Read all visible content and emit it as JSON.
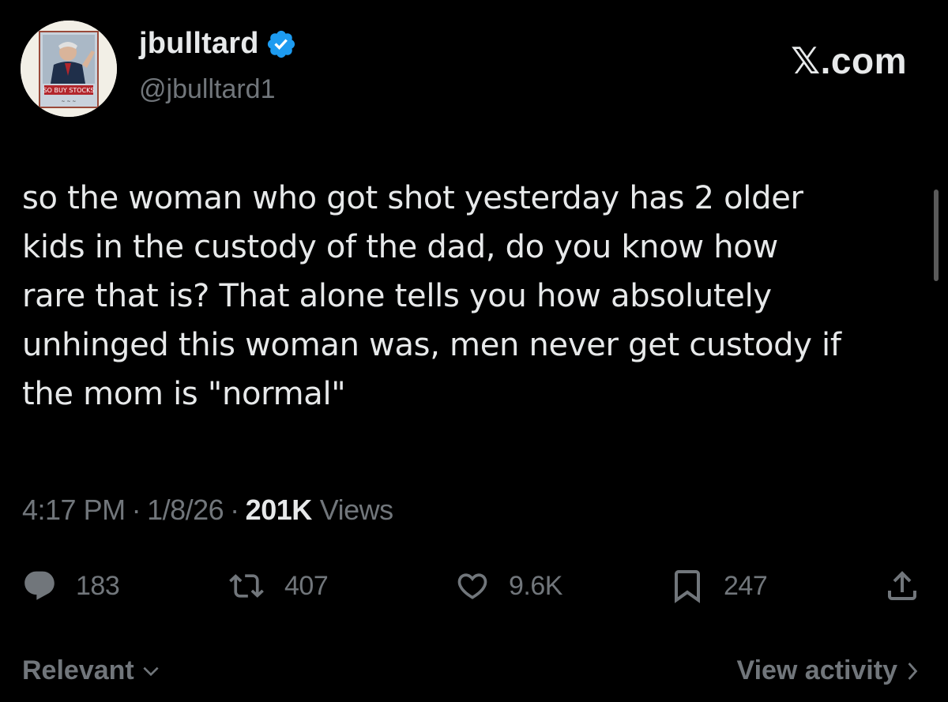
{
  "author": {
    "display_name": "jbulltard",
    "handle": "@jbulltard1",
    "verified": true,
    "avatar_icon": "avatar-image"
  },
  "brand": "𝕏.com",
  "tweet": {
    "text": "so the woman who got shot yesterday has 2 older\nkids in the custody of the dad, do you know how\nrare that is? That alone tells you how absolutely\nunhinged this woman was, men never get custody if\nthe mom is \"normal\""
  },
  "meta": {
    "time": "4:17 PM",
    "separator": "·",
    "date": "1/8/26",
    "views_count": "201K",
    "views_label": "Views"
  },
  "actions": {
    "replies": "183",
    "reposts": "407",
    "likes": "9.6K",
    "bookmarks": "247"
  },
  "footer": {
    "sort_label": "Relevant",
    "view_activity": "View activity"
  },
  "colors": {
    "background": "#000000",
    "text_primary": "#e7e9ea",
    "text_secondary": "#71767b",
    "verified_blue": "#1d9bf0"
  }
}
